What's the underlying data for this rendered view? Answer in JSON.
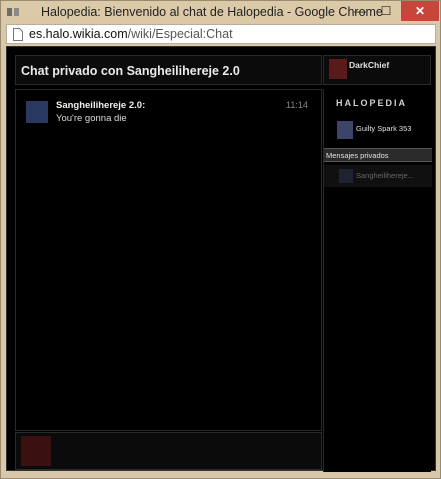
{
  "window": {
    "title": "Halopedia: Bienvenido al chat de Halopedia - Google Chrome",
    "minimize_glyph": "—",
    "maximize_glyph": "☐",
    "close_glyph": "✕"
  },
  "address_bar": {
    "url_host": "es.halo.wikia.com",
    "url_path": "/wiki/Especial:Chat"
  },
  "chat": {
    "title": "Chat privado con Sangheilihereje 2.0",
    "current_user": "DarkChief",
    "messages": [
      {
        "author": "Sangheilihereje 2.0:",
        "time": "11:14",
        "text": "You're gonna die"
      }
    ]
  },
  "sidebar": {
    "wiki_logo": "HALOPEDIA",
    "users": [
      {
        "name": "Guilty Spark 353"
      }
    ],
    "private_header": "Mensajes privados",
    "private_chats": [
      {
        "name": "Sangheilihereje..."
      }
    ]
  },
  "colors": {
    "chrome_frame": "#dcc9a8",
    "close_button": "#c7463c",
    "chat_bg": "#000000",
    "pm_header_bg": "#2b2b2b"
  },
  "icons": {
    "app": "window-app-icon",
    "page": "page-icon"
  }
}
